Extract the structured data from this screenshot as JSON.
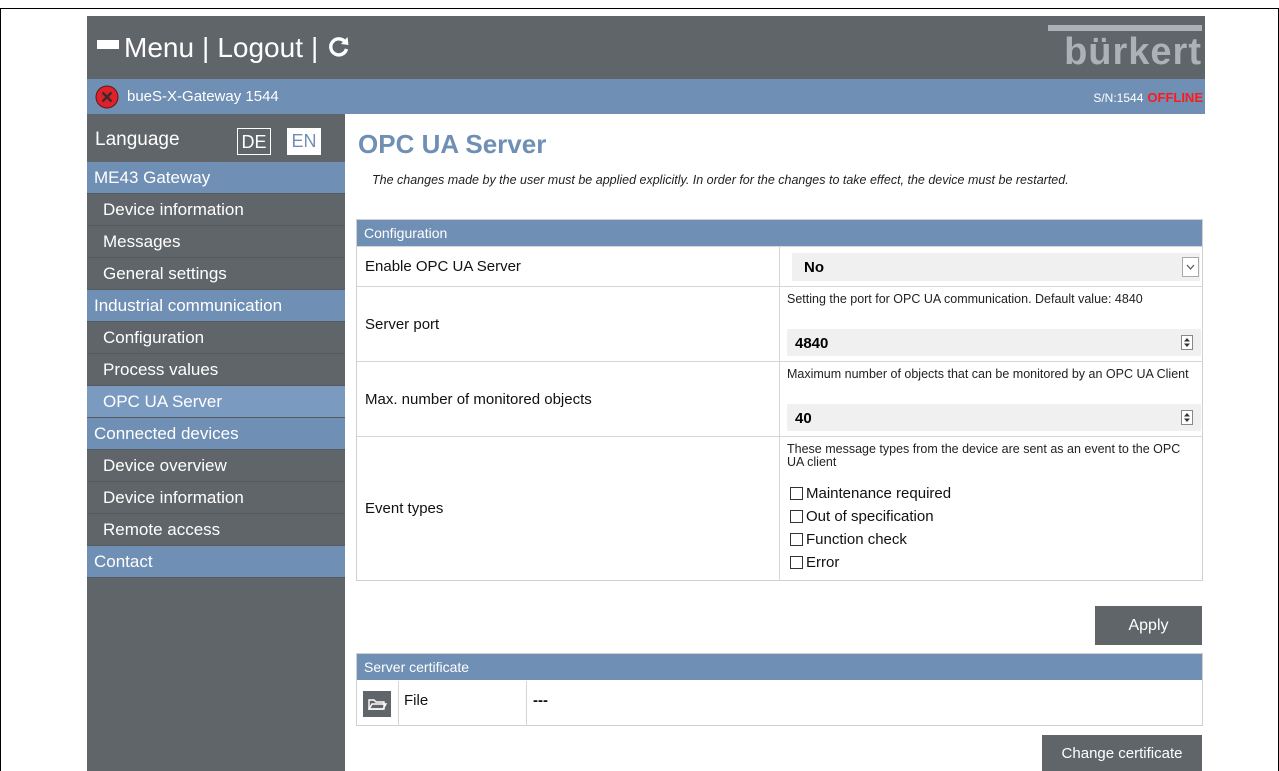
{
  "header": {
    "menu_label": "Menu",
    "separator": "|",
    "logout_label": "Logout",
    "brand": "bürkert",
    "refresh_icon": "refresh-icon"
  },
  "status": {
    "device_name": "bueS-X-Gateway 1544",
    "serial": "S/N:1544",
    "state": "OFFLINE",
    "state_color": "#ff1a1a"
  },
  "sidebar": {
    "language_label": "Language",
    "lang_de": "DE",
    "lang_en": "EN",
    "items": [
      {
        "label": "ME43 Gateway",
        "type": "section"
      },
      {
        "label": "Device information",
        "type": "sub"
      },
      {
        "label": "Messages",
        "type": "sub"
      },
      {
        "label": "General settings",
        "type": "sub"
      },
      {
        "label": "Industrial communication",
        "type": "section"
      },
      {
        "label": "Configuration",
        "type": "sub"
      },
      {
        "label": "Process values",
        "type": "sub"
      },
      {
        "label": "OPC UA Server",
        "type": "sub",
        "active": true
      },
      {
        "label": "Connected devices",
        "type": "section"
      },
      {
        "label": "Device overview",
        "type": "sub"
      },
      {
        "label": "Device information",
        "type": "sub"
      },
      {
        "label": "Remote access",
        "type": "sub"
      },
      {
        "label": "Contact",
        "type": "section"
      }
    ]
  },
  "main": {
    "title": "OPC UA Server",
    "info": "The changes made by the user must be applied explicitly. In order for the changes to take effect, the device must be restarted.",
    "config": {
      "heading": "Configuration",
      "enable_label": "Enable OPC UA Server",
      "enable_value": "No",
      "port_label": "Server port",
      "port_hint": "Setting the port for OPC UA communication. Default value: 4840",
      "port_value": "4840",
      "max_label": "Max. number of monitored objects",
      "max_hint": "Maximum number of objects that can be monitored by an OPC UA Client",
      "max_value": "40",
      "event_label": "Event types",
      "event_hint": "These message types from the device are sent as an event to the OPC UA client",
      "events": [
        "Maintenance required",
        "Out of specification",
        "Function check",
        "Error"
      ]
    },
    "apply_label": "Apply",
    "cert": {
      "heading": "Server certificate",
      "file_label": "File",
      "file_value": "---",
      "change_label": "Change certificate"
    }
  },
  "colors": {
    "accent": "#6f8fb4",
    "dark": "#5f6569"
  }
}
